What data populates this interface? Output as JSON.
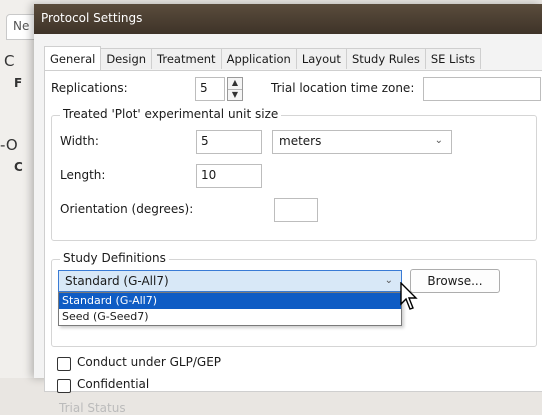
{
  "background_app": {
    "tab_label": "Ne",
    "letter_1": "C",
    "letter_2": "F",
    "letter_3": "-O",
    "letter_4": "C"
  },
  "dialog": {
    "title": "Protocol Settings"
  },
  "tabs": [
    {
      "label": "General",
      "active": true
    },
    {
      "label": "Design",
      "active": false
    },
    {
      "label": "Treatment",
      "active": false
    },
    {
      "label": "Application",
      "active": false
    },
    {
      "label": "Layout",
      "active": false
    },
    {
      "label": "Study Rules",
      "active": false
    },
    {
      "label": "SE Lists",
      "active": false
    }
  ],
  "general": {
    "replications_label": "Replications:",
    "replications_value": "5",
    "timezone_label": "Trial location time zone:",
    "timezone_value": "",
    "plot_group_title": "Treated 'Plot' experimental unit size",
    "width_label": "Width:",
    "width_value": "5",
    "unit_value": "meters",
    "length_label": "Length:",
    "length_value": "10",
    "orientation_label": "Orientation (degrees):",
    "orientation_value": "",
    "study_group_title": "Study Definitions",
    "study_selected": "Standard (G-All7)",
    "study_options": [
      "Standard (G-All7)",
      "Seed (G-Seed7)"
    ],
    "browse_label": "Browse...",
    "glp_label": "Conduct under GLP/GEP",
    "confidential_label": "Confidential",
    "trial_status_label": "Trial Status"
  }
}
